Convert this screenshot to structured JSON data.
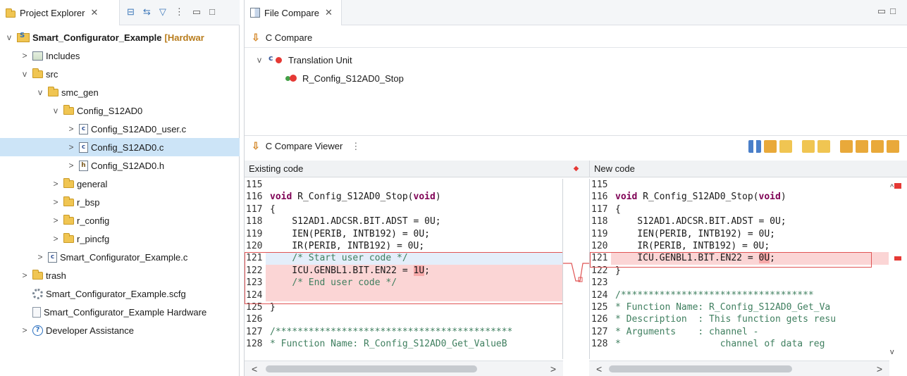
{
  "project_explorer": {
    "tab_title": "Project Explorer",
    "tab_close": "✕",
    "tree": [
      {
        "depth": 0,
        "twisty": "v",
        "icon": "project-icon",
        "label": "Smart_Configurator_Example",
        "decoration": "[Hardwar",
        "bold": true
      },
      {
        "depth": 1,
        "twisty": ">",
        "icon": "includes-icon",
        "label": "Includes"
      },
      {
        "depth": 1,
        "twisty": "v",
        "icon": "src-folder-icon",
        "label": "src"
      },
      {
        "depth": 2,
        "twisty": "v",
        "icon": "folder-icon",
        "label": "smc_gen"
      },
      {
        "depth": 3,
        "twisty": "v",
        "icon": "folder-icon",
        "label": "Config_S12AD0"
      },
      {
        "depth": 4,
        "twisty": ">",
        "icon": "c-file-icon",
        "label": "Config_S12AD0_user.c"
      },
      {
        "depth": 4,
        "twisty": ">",
        "icon": "c-file-icon",
        "label": "Config_S12AD0.c",
        "selected": true
      },
      {
        "depth": 4,
        "twisty": ">",
        "icon": "h-file-icon",
        "label": "Config_S12AD0.h"
      },
      {
        "depth": 3,
        "twisty": ">",
        "icon": "folder-icon",
        "label": "general"
      },
      {
        "depth": 3,
        "twisty": ">",
        "icon": "folder-icon",
        "label": "r_bsp"
      },
      {
        "depth": 3,
        "twisty": ">",
        "icon": "folder-icon",
        "label": "r_config"
      },
      {
        "depth": 3,
        "twisty": ">",
        "icon": "folder-icon",
        "label": "r_pincfg"
      },
      {
        "depth": 2,
        "twisty": ">",
        "icon": "c-file-icon",
        "label": "Smart_Configurator_Example.c"
      },
      {
        "depth": 1,
        "twisty": ">",
        "icon": "folder-icon",
        "label": "trash"
      },
      {
        "depth": 1,
        "twisty": "",
        "icon": "gear-icon",
        "label": "Smart_Configurator_Example.scfg"
      },
      {
        "depth": 1,
        "twisty": "",
        "icon": "doc-icon",
        "label": "Smart_Configurator_Example Hardware"
      },
      {
        "depth": 1,
        "twisty": ">",
        "icon": "help-icon",
        "label": "Developer Assistance"
      }
    ]
  },
  "file_compare": {
    "tab_title": "File Compare",
    "tab_close": "✕",
    "header_label": "C Compare",
    "structure": [
      {
        "label": "Translation Unit",
        "twisty": "v",
        "icon": "translation-unit-icon"
      },
      {
        "label": "R_Config_S12AD0_Stop",
        "icon": "function-icon"
      }
    ],
    "viewer_label": "C Compare Viewer",
    "left_pane_title": "Existing code",
    "right_pane_title": "New code"
  },
  "code_left": [
    {
      "ln": "115",
      "tokens": [
        {
          "t": ""
        }
      ]
    },
    {
      "ln": "116",
      "tokens": [
        {
          "t": "void",
          "c": "kw"
        },
        {
          "t": " R_Config_S12AD0_Stop("
        },
        {
          "t": "void",
          "c": "kw"
        },
        {
          "t": ")"
        }
      ]
    },
    {
      "ln": "117",
      "tokens": [
        {
          "t": "{"
        }
      ]
    },
    {
      "ln": "118",
      "tokens": [
        {
          "t": "    S12AD1.ADCSR.BIT.ADST = 0U;"
        }
      ]
    },
    {
      "ln": "119",
      "tokens": [
        {
          "t": "    IEN(PERIB, INTB192) = 0U;"
        }
      ]
    },
    {
      "ln": "120",
      "tokens": [
        {
          "t": "    IR(PERIB, INTB192) = 0U;"
        }
      ]
    },
    {
      "ln": "121",
      "changed": true,
      "focus": true,
      "tokens": [
        {
          "t": "    "
        },
        {
          "t": "/* Start user code */",
          "c": "cm"
        }
      ]
    },
    {
      "ln": "122",
      "changed": true,
      "tokens": [
        {
          "t": "    ICU.GENBL1.BIT.EN22 = "
        },
        {
          "t": "1U",
          "c": "hl"
        },
        {
          "t": ";"
        }
      ]
    },
    {
      "ln": "123",
      "changed": true,
      "tokens": [
        {
          "t": "    "
        },
        {
          "t": "/* End user code */",
          "c": "cm"
        }
      ]
    },
    {
      "ln": "124",
      "changed": true,
      "tokens": [
        {
          "t": ""
        }
      ]
    },
    {
      "ln": "125",
      "tokens": [
        {
          "t": "}"
        }
      ]
    },
    {
      "ln": "126",
      "tokens": [
        {
          "t": ""
        }
      ]
    },
    {
      "ln": "127",
      "tokens": [
        {
          "t": "/*******************************************",
          "c": "cm"
        }
      ]
    },
    {
      "ln": "128",
      "tokens": [
        {
          "t": "* Function Name: R_Config_S12AD0_Get_ValueB",
          "c": "cm"
        }
      ]
    }
  ],
  "code_right": [
    {
      "ln": "115",
      "tokens": [
        {
          "t": ""
        }
      ]
    },
    {
      "ln": "116",
      "tokens": [
        {
          "t": "void",
          "c": "kw"
        },
        {
          "t": " R_Config_S12AD0_Stop("
        },
        {
          "t": "void",
          "c": "kw"
        },
        {
          "t": ")"
        }
      ]
    },
    {
      "ln": "117",
      "tokens": [
        {
          "t": "{"
        }
      ]
    },
    {
      "ln": "118",
      "tokens": [
        {
          "t": "    S12AD1.ADCSR.BIT.ADST = 0U;"
        }
      ]
    },
    {
      "ln": "119",
      "tokens": [
        {
          "t": "    IEN(PERIB, INTB192) = 0U;"
        }
      ]
    },
    {
      "ln": "120",
      "tokens": [
        {
          "t": "    IR(PERIB, INTB192) = 0U;"
        }
      ]
    },
    {
      "ln": "121",
      "changed": true,
      "tokens": [
        {
          "t": "    ICU.GENBL1.BIT.EN22 = "
        },
        {
          "t": "0U",
          "c": "hl"
        },
        {
          "t": ";"
        }
      ]
    },
    {
      "ln": "122",
      "tokens": [
        {
          "t": "}"
        }
      ]
    },
    {
      "ln": "123",
      "tokens": [
        {
          "t": ""
        }
      ]
    },
    {
      "ln": "124",
      "tokens": [
        {
          "t": "/***********************************",
          "c": "cm"
        }
      ]
    },
    {
      "ln": "125",
      "tokens": [
        {
          "t": "* Function Name: R_Config_S12AD0_Get_Va",
          "c": "cm"
        }
      ]
    },
    {
      "ln": "126",
      "tokens": [
        {
          "t": "* Description  : This function gets resu",
          "c": "cm"
        }
      ]
    },
    {
      "ln": "127",
      "tokens": [
        {
          "t": "* Arguments    : channel -",
          "c": "cm"
        }
      ]
    },
    {
      "ln": "128",
      "tokens": [
        {
          "t": "*                  channel of data reg",
          "c": "cm"
        }
      ]
    }
  ],
  "scroll": {
    "left_arrow": "<",
    "right_arrow": ">",
    "up_arrow": "^",
    "down_arrow": "v"
  },
  "colors": {
    "diff_red": "#e05454",
    "changed_bg": "#fbd5d5",
    "selection": "#cce4f7"
  }
}
